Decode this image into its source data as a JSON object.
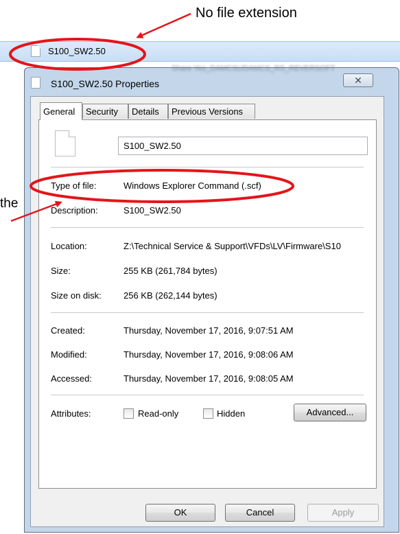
{
  "annotations": {
    "no_extension_note": "No file extension",
    "partial_note": "the"
  },
  "explorer_row": {
    "file_name": "S100_SW2.50"
  },
  "dialog": {
    "title": "S100_SW2.50 Properties",
    "close_glyph": "✕",
    "tabs": [
      {
        "label": "General"
      },
      {
        "label": "Security"
      },
      {
        "label": "Details"
      },
      {
        "label": "Previous Versions"
      }
    ],
    "name_value": "S100_SW2.50",
    "fields": {
      "type_label": "Type of file:",
      "type_value": "Windows Explorer Command (.scf)",
      "description_label": "Description:",
      "description_value": "S100_SW2.50",
      "location_label": "Location:",
      "location_value": "Z:\\Technical Service & Support\\VFDs\\LV\\Firmware\\S10",
      "size_label": "Size:",
      "size_value": "255 KB (261,784 bytes)",
      "size_on_disk_label": "Size on disk:",
      "size_on_disk_value": "256 KB (262,144 bytes)",
      "created_label": "Created:",
      "created_value": "Thursday, November 17, 2016, 9:07:51 AM",
      "modified_label": "Modified:",
      "modified_value": "Thursday, November 17, 2016, 9:08:06 AM",
      "accessed_label": "Accessed:",
      "accessed_value": "Thursday, November 17, 2016, 9:08:05 AM",
      "attributes_label": "Attributes:",
      "readonly_label": "Read-only",
      "hidden_label": "Hidden",
      "advanced_label": "Advanced..."
    },
    "buttons": {
      "ok": "OK",
      "cancel": "Cancel",
      "apply": "Apply"
    }
  },
  "colors": {
    "annotation_red": "#e3151a",
    "selection_blue": "#cfe3fa",
    "window_frame": "#c3d6ea"
  }
}
